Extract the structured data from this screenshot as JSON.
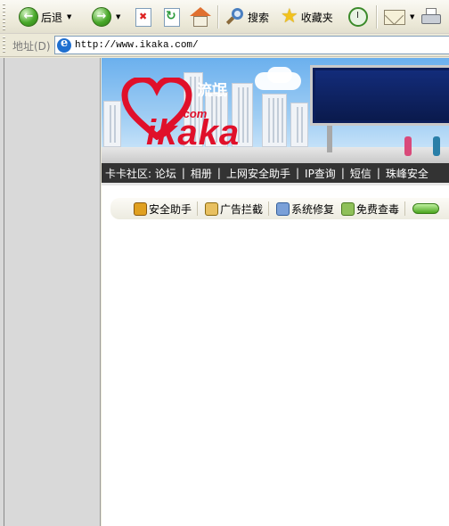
{
  "toolbar": {
    "back_label": "后退",
    "search_label": "搜索",
    "favorites_label": "收藏夹"
  },
  "address": {
    "label": "地址(D)",
    "url": "http://www.ikaka.com/"
  },
  "banner": {
    "logo_com": ".com",
    "logo_text": "ikaka",
    "billboard_text": "流氓"
  },
  "nav": {
    "items": [
      "卡卡社区: 论坛",
      "相册",
      "上网安全助手",
      "IP查询",
      "短信",
      "珠峰安全"
    ]
  },
  "assistant_bar": {
    "items": [
      "安全助手",
      "广告拦截",
      "系统修复",
      "免费查毒"
    ]
  },
  "colors": {
    "brand_red": "#e0102a",
    "navbar_bg": "#333333",
    "billboard_bg": "#0c1e5a"
  }
}
